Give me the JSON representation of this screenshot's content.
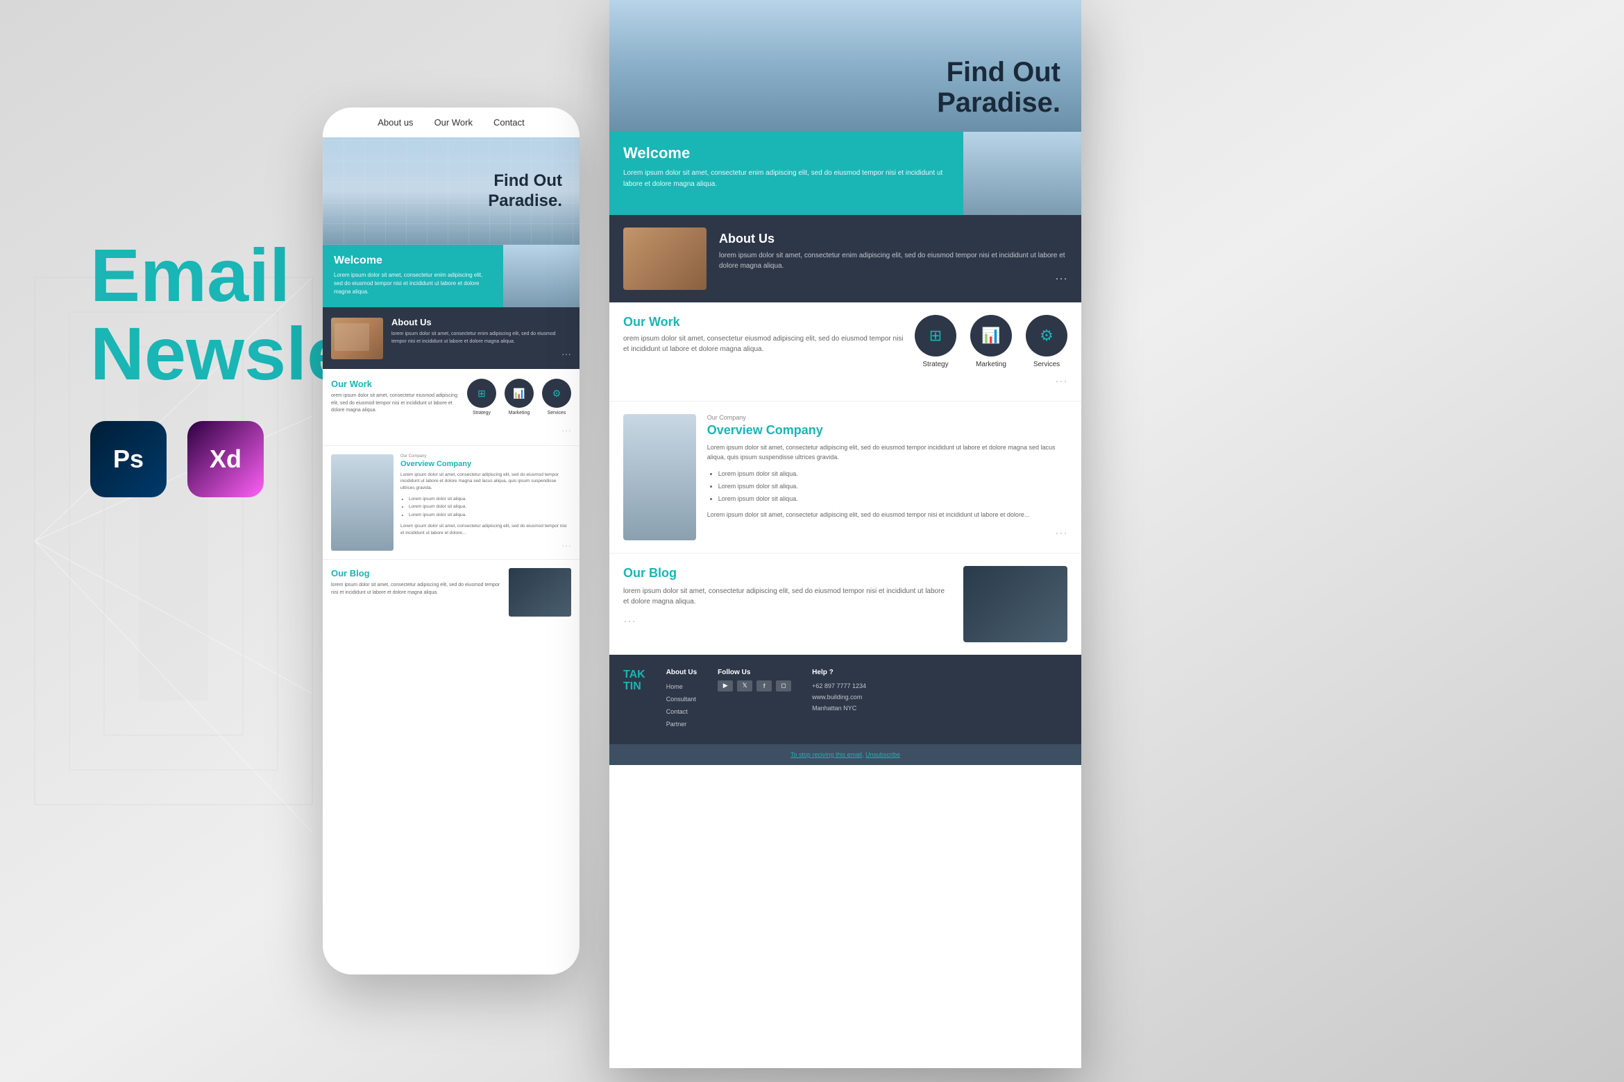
{
  "page": {
    "title": "Email Newsletter",
    "subtitle": "Email\nNewsletter",
    "software": {
      "ps": "Ps",
      "xd": "Xd"
    }
  },
  "nav": {
    "about": "About us",
    "work": "Our Work",
    "contact": "Contact"
  },
  "hero": {
    "line1": "Find Out",
    "line2": "Paradise."
  },
  "welcome": {
    "title": "Welcome",
    "body": "Lorem ipsum dolor sit amet, consectetur enim adipiscing elit, sed do eiusmod tempor nisi et incididunt ut labore et dolore magna aliqua."
  },
  "about": {
    "title": "About Us",
    "body": "lorem ipsum dolor sit amet, consectetur enim adipiscing elit, sed do eiusmod tempor nisi et incididunt ut labore et dolore magna aliqua."
  },
  "ourwork": {
    "title": "Our Work",
    "body": "orem ipsum dolor sit amet, consectetur eiusmod adipiscing elit, sed do eiusmod tempor nisi et incididunt ut labore et dolore magna aliqua.",
    "icons": [
      {
        "label": "Strategy",
        "icon": "⊞"
      },
      {
        "label": "Marketing",
        "icon": "📈"
      },
      {
        "label": "Services",
        "icon": "⚙"
      }
    ]
  },
  "overview": {
    "subtitle": "Our Company",
    "title": "Overview Company",
    "body1": "Lorem ipsum dolor sit amet, consectetur adipiscing elit, sed do eiusmod tempor incididunt ut labore et dolore magna sed lacus aliqua, quis ipsum suspendisse ultrices gravida.",
    "list": [
      "Lorem ipsum dolor sit aliqua.",
      "Lorem ipsum dolor sit aliqua.",
      "Lorem ipsum dolor sit aliqua."
    ],
    "body2": "Lorem ipsum dolor sit amet, consectetur adipiscing elit, sed do eiusmod tempor nisi et incididunt ut labore et dolore..."
  },
  "blog": {
    "title": "Our Blog",
    "body": "lorem ipsum dolor sit amet, consectetur adipiscing elit, sed do eiusmod tempor nisi et incididunt ut labore et dolore magna aliqua."
  },
  "footer": {
    "brand": "TAK\nTIN",
    "links_title": "About Us",
    "links": [
      "Home",
      "Consultant",
      "Contact",
      "Partner"
    ],
    "follow_title": "Follow Us",
    "help_title": "Help ?",
    "phone": "+62 897 7777 1234",
    "website": "www.building.com",
    "city": "Manhattan NYC",
    "unsub": "To stop reciving this email,",
    "unsub_link": "Unsubscribe"
  }
}
